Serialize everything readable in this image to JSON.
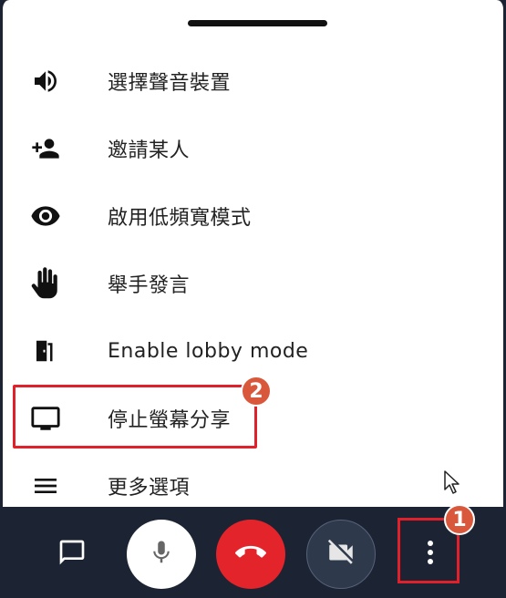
{
  "menu": {
    "items": [
      {
        "label": "選擇聲音裝置",
        "icon": "volume-icon"
      },
      {
        "label": "邀請某人",
        "icon": "person-add-icon"
      },
      {
        "label": "啟用低頻寬模式",
        "icon": "eye-icon"
      },
      {
        "label": "舉手發言",
        "icon": "raised-hand-icon"
      },
      {
        "label": "Enable lobby mode",
        "icon": "door-icon"
      },
      {
        "label": "停止螢幕分享",
        "icon": "monitor-icon"
      },
      {
        "label": "更多選項",
        "icon": "menu-icon"
      }
    ]
  },
  "annotations": {
    "badge_1": "1",
    "badge_2": "2",
    "highlight_color": "#e0202a",
    "badge_color": "#d9583b"
  },
  "toolbar": {
    "buttons": [
      "chat-icon",
      "microphone-icon",
      "hangup-icon",
      "camera-off-icon",
      "more-vertical-icon"
    ],
    "hangup_color": "#e3242b",
    "background": "#1c2433"
  }
}
